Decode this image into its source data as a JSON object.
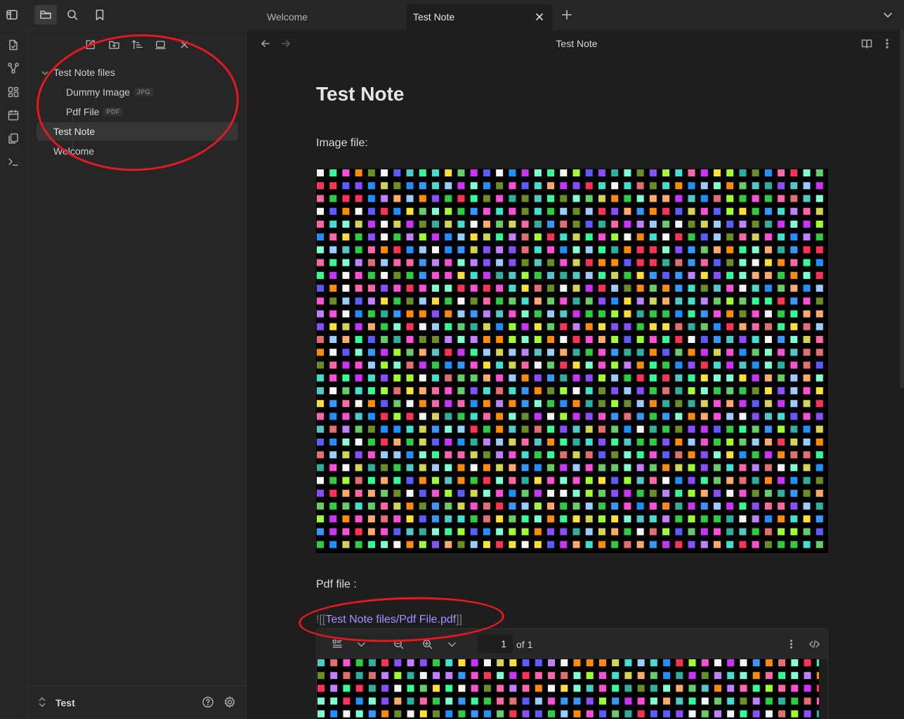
{
  "tabs": [
    {
      "label": "Welcome",
      "active": false
    },
    {
      "label": "Test Note",
      "active": true
    }
  ],
  "sidebar": {
    "tree": [
      {
        "label": "Test Note files",
        "type": "folder"
      },
      {
        "label": "Dummy Image",
        "badge": "JPG"
      },
      {
        "label": "Pdf File",
        "badge": "PDF"
      },
      {
        "label": "Test Note",
        "active": true
      },
      {
        "label": "Welcome"
      }
    ],
    "vault_name": "Test"
  },
  "view": {
    "title": "Test Note"
  },
  "note": {
    "heading": "Test Note",
    "image_label": "Image file:",
    "pdf_label": "Pdf file :",
    "embed_prefix": "![[",
    "embed_link": "Test Note files/Pdf File.pdf",
    "embed_suffix": "]]"
  },
  "pdf_viewer": {
    "page_current": "1",
    "page_total": "of 1"
  },
  "icons": [
    "sidebar-toggle-icon",
    "folder-icon",
    "search-icon",
    "bookmark-icon",
    "plus-icon",
    "chevron-down-icon",
    "close-icon",
    "new-note-icon",
    "new-folder-icon",
    "sort-icon",
    "collapse-icon",
    "graph-icon",
    "canvas-icon",
    "calendar-icon",
    "templates-icon",
    "terminal-icon",
    "help-icon",
    "settings-icon",
    "reading-view-icon",
    "more-options-icon",
    "outline-icon",
    "zoom-out-icon",
    "zoom-in-icon",
    "code-icon"
  ],
  "annotation_color": "#e5191f"
}
